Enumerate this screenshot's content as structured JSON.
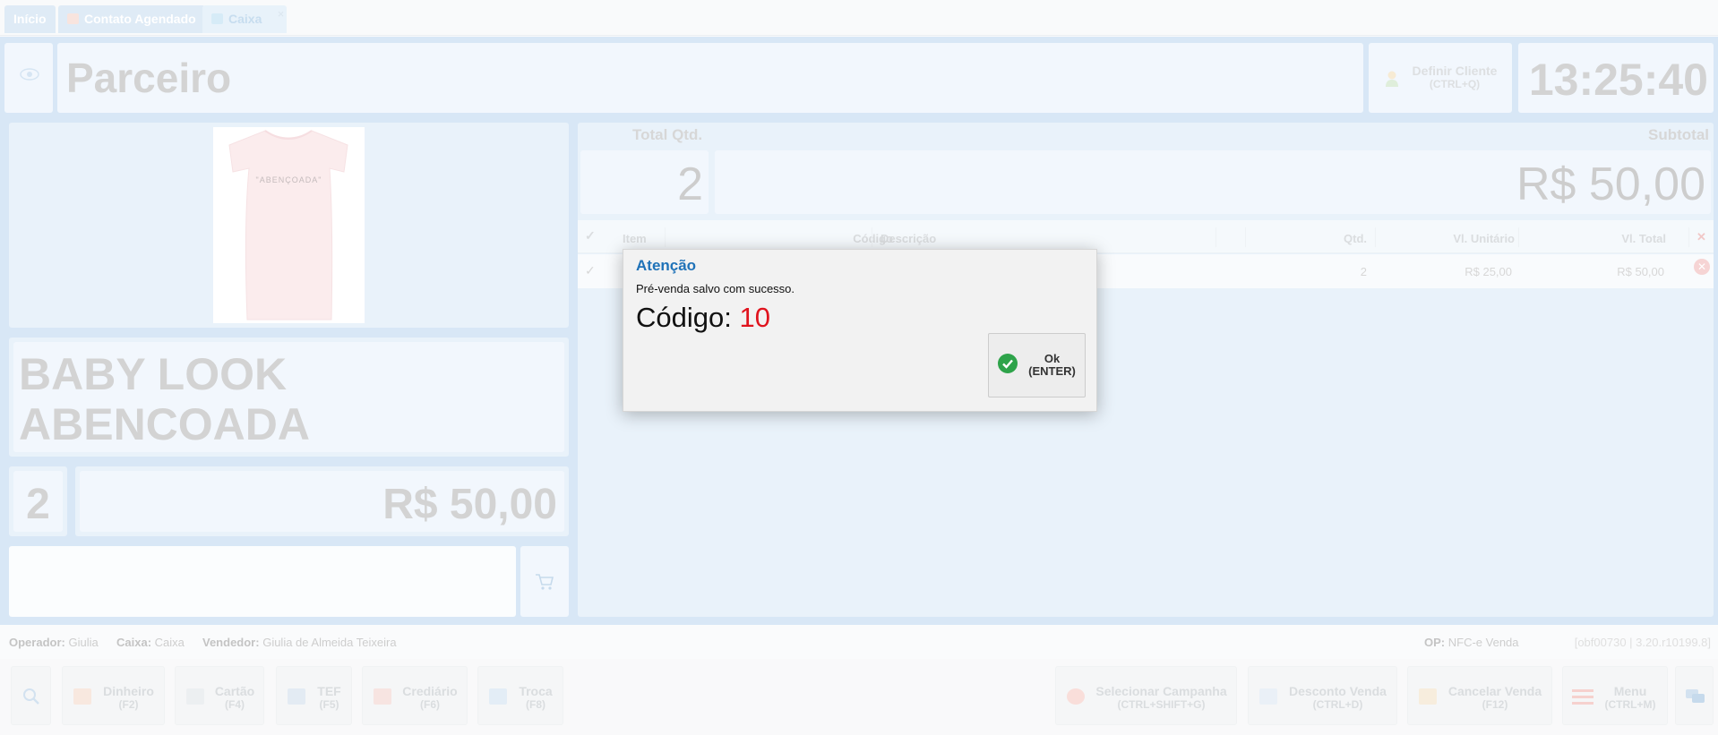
{
  "tabs": [
    {
      "label": "Início"
    },
    {
      "label": "Contato Agendado"
    },
    {
      "label": "Caixa",
      "close": "×"
    }
  ],
  "header": {
    "partner_label": "Parceiro",
    "define_client_label": "Definir Cliente",
    "define_client_shortcut": "(CTRL+Q)",
    "clock": "13:25:40"
  },
  "product": {
    "image_text": "\"ABENÇOADA\"",
    "name": "BABY LOOK ABENCOADA",
    "quantity": "2",
    "price": "R$ 50,00"
  },
  "totals": {
    "qty_label": "Total Qtd.",
    "qty_value": "2",
    "subtotal_label": "Subtotal",
    "subtotal_value": "R$ 50,00"
  },
  "table": {
    "columns": [
      "Item",
      "Código",
      "Descrição",
      "Qtd.",
      "Vl. Unitário",
      "Vl. Total"
    ],
    "rows": [
      {
        "qty": "2",
        "unit": "R$ 25,00",
        "total": "R$ 50,00"
      }
    ]
  },
  "status": {
    "operator_label": "Operador:",
    "operator_value": "Giulia",
    "cashier_label": "Caixa:",
    "cashier_value": "Caixa",
    "seller_label": "Vendedor:",
    "seller_value": "Giulia de Almeida Teixeira",
    "op_label": "OP:",
    "op_value": "NFC-e Venda",
    "version": "[obf00730 | 3.20.r10199.8]"
  },
  "footer": {
    "dinheiro": {
      "label": "Dinheiro",
      "key": "(F2)"
    },
    "cartao": {
      "label": "Cartão",
      "key": "(F4)"
    },
    "tef": {
      "label": "TEF",
      "key": "(F5)"
    },
    "crediario": {
      "label": "Crediário",
      "key": "(F6)"
    },
    "troca": {
      "label": "Troca",
      "key": "(F8)"
    },
    "campanha": {
      "label": "Selecionar Campanha",
      "key": "(CTRL+SHIFT+G)"
    },
    "desconto": {
      "label": "Desconto Venda",
      "key": "(CTRL+D)"
    },
    "cancelar": {
      "label": "Cancelar Venda",
      "key": "(F12)"
    },
    "menu": {
      "label": "Menu",
      "key": "(CTRL+M)"
    }
  },
  "dialog": {
    "title": "Atenção",
    "message": "Pré-venda salvo com sucesso.",
    "code_label": "Código:",
    "code_value": "10",
    "ok_label": "Ok",
    "ok_shortcut": "(ENTER)"
  },
  "colors": {
    "workspace": "#bcd6ef",
    "dialog_title": "#1f72b8",
    "code_value": "#e0141e",
    "ok_icon": "#2ea34a"
  }
}
